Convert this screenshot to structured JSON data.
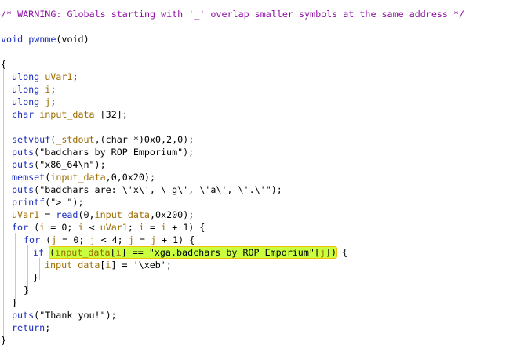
{
  "decompiler": {
    "warning": "/* WARNING: Globals starting with '_' overlap smaller symbols at the same address */",
    "signature": {
      "ret_type": "void",
      "name": "pwnme",
      "params": "(void)"
    },
    "open_brace": "{",
    "close_brace": "}",
    "declarations": [
      {
        "type": "ulong",
        "name": "uVar1",
        "suffix": ";"
      },
      {
        "type": "ulong",
        "name": "i",
        "suffix": ";"
      },
      {
        "type": "ulong",
        "name": "j",
        "suffix": ";"
      },
      {
        "type": "char",
        "name": "input_data",
        "suffix": " [32];"
      }
    ],
    "statements": {
      "setvbuf": {
        "fn": "setvbuf",
        "open": "(",
        "arg1": "_stdout",
        "mid": ",(char *)0x0,2,0);"
      },
      "puts1": {
        "fn": "puts",
        "rest": "(\"badchars by ROP Emporium\");"
      },
      "puts2": {
        "fn": "puts",
        "rest": "(\"x86_64\\n\");"
      },
      "memset": {
        "fn": "memset",
        "open": "(",
        "arg1": "input_data",
        "rest": ",0,0x20);"
      },
      "puts3": {
        "fn": "puts",
        "rest": "(\"badchars are: \\'x\\', \\'g\\', \\'a\\', \\'.\\'\");"
      },
      "printf": {
        "fn": "printf",
        "rest": "(\"> \");"
      },
      "read": {
        "lhs": "uVar1",
        "eq": " = ",
        "fn": "read",
        "open": "(0,",
        "arg": "input_data",
        "rest": ",0x200);"
      },
      "for_outer": {
        "kw": "for",
        "p1": " (",
        "v1": "i",
        "p2": " = 0; ",
        "v2": "i",
        "p3": " < ",
        "v3": "uVar1",
        "p4": "; ",
        "v4": "i",
        "p5": " = ",
        "v5": "i",
        "p6": " + 1) {"
      },
      "for_inner": {
        "kw": "for",
        "p1": " (",
        "v1": "j",
        "p2": " = 0; ",
        "v2": "j",
        "p3": " < 4; ",
        "v3": "j",
        "p4": " = ",
        "v4": "j",
        "p5": " + 1) {"
      },
      "if_stmt": {
        "kw": "if",
        "sp": " ",
        "hl_a": "(",
        "hl_v1": "input_data",
        "hl_b": "[",
        "hl_v2": "i",
        "hl_c": "] == \"xga.badchars by ROP Emporium\"[",
        "hl_v3": "j",
        "hl_d": "])",
        "tail": " {"
      },
      "assign": {
        "v1": "input_data",
        "a": "[",
        "v2": "i",
        "b": "] = '\\xeb';"
      },
      "brace_if": "}",
      "brace_inner": "}",
      "brace_outer": "}",
      "puts4": {
        "fn": "puts",
        "rest": "(\"Thank you!\");"
      },
      "ret": {
        "kw": "return",
        "rest": ";"
      }
    },
    "colors": {
      "comment": "#8e0ea3",
      "keyword": "#1d2fbf",
      "variable": "#9b6c00",
      "highlight": "#c9ff3f"
    }
  }
}
